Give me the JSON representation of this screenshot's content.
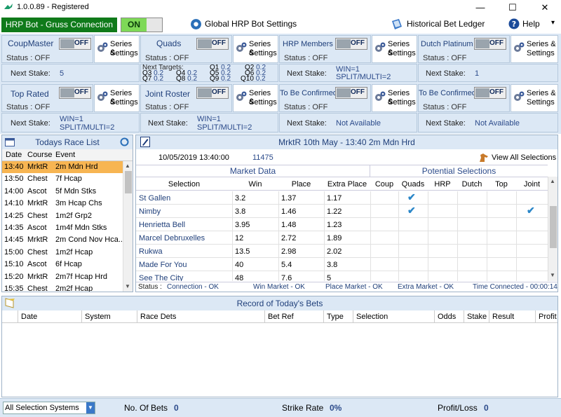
{
  "window": {
    "title": "1.0.0.89 - Registered",
    "minimize": "—",
    "maximize": "☐",
    "close": "✕"
  },
  "toolbar": {
    "connection": "HRP Bot - Gruss Connection",
    "on_label": "ON",
    "global_settings": "Global HRP Bot Settings",
    "ledger": "Historical Bet Ledger",
    "help": "Help",
    "help_caret": "▾"
  },
  "common": {
    "off": "OFF",
    "status_label": "Status :",
    "status_value": "OFF",
    "next_stake": "Next Stake:",
    "series": "Series &",
    "settings": "Settings"
  },
  "systems": {
    "coupmaster": {
      "name": "CoupMaster",
      "stake_label": "Next Stake:",
      "stake": "5"
    },
    "quads": {
      "name": "Quads",
      "targets_label": "Next Targets:",
      "targets": [
        [
          "Q1",
          "0.2"
        ],
        [
          "Q2",
          "0.2"
        ],
        [
          "Q3",
          "0.2"
        ],
        [
          "Q4",
          "0.2"
        ],
        [
          "Q5",
          "0.2"
        ],
        [
          "Q6",
          "0.2"
        ],
        [
          "Q7",
          "0.2"
        ],
        [
          "Q8",
          "0.2"
        ],
        [
          "Q9",
          "0.2"
        ],
        [
          "Q10",
          "0.2"
        ]
      ]
    },
    "hrp_members": {
      "name": "HRP Members",
      "stake_label": "Next Stake:",
      "stake1": "WIN=1",
      "stake2": "SPLIT/MULTI=2"
    },
    "dutch_platinum": {
      "name": "Dutch Platinum",
      "stake_label": "Next Stake:",
      "stake": "1"
    },
    "top_rated": {
      "name": "Top Rated",
      "stake_label": "Next Stake:",
      "stake1": "WIN=1",
      "stake2": "SPLIT/MULTI=2"
    },
    "joint_roster": {
      "name": "Joint Roster",
      "stake_label": "Next Stake:",
      "stake1": "WIN=1",
      "stake2": "SPLIT/MULTI=2"
    },
    "tbc1": {
      "name": "To Be Confirmed",
      "stake_label": "Next Stake:",
      "stake": "Not Available"
    },
    "tbc2": {
      "name": "To Be Confirmed",
      "stake_label": "Next Stake:",
      "stake": "Not Available"
    }
  },
  "racelist": {
    "title": "Todays Race List",
    "headers": {
      "date": "Date",
      "course": "Course",
      "event": "Event"
    },
    "rows": [
      {
        "time": "13:40",
        "course": "MrktR",
        "event": "2m Mdn Hrd"
      },
      {
        "time": "13:50",
        "course": "Chest",
        "event": "7f Hcap"
      },
      {
        "time": "14:00",
        "course": "Ascot",
        "event": "5f Mdn Stks"
      },
      {
        "time": "14:10",
        "course": "MrktR",
        "event": "3m Hcap Chs"
      },
      {
        "time": "14:25",
        "course": "Chest",
        "event": "1m2f Grp2"
      },
      {
        "time": "14:35",
        "course": "Ascot",
        "event": "1m4f Mdn Stks"
      },
      {
        "time": "14:45",
        "course": "MrktR",
        "event": "2m Cond Nov Hca..."
      },
      {
        "time": "15:00",
        "course": "Chest",
        "event": "1m2f Hcap"
      },
      {
        "time": "15:10",
        "course": "Ascot",
        "event": "6f Hcap"
      },
      {
        "time": "15:20",
        "course": "MrktR",
        "event": "2m7f Hcap Hrd"
      },
      {
        "time": "15:35",
        "course": "Chest",
        "event": "2m2f Hcap"
      }
    ]
  },
  "market": {
    "title": "MrktR  10th May - 13:40 2m Mdn Hrd",
    "datetime": "10/05/2019 13:40:00",
    "market_id": "11475",
    "view_all": "View All Selections",
    "market_data_label": "Market Data",
    "potential_label": "Potential Selections",
    "headers": {
      "selection": "Selection",
      "win": "Win",
      "place": "Place",
      "extra": "Extra Place",
      "coup": "Coup",
      "quads": "Quads",
      "hrp": "HRP",
      "dutch": "Dutch",
      "top": "Top",
      "joint": "Joint"
    },
    "rows": [
      {
        "name": "St Gallen",
        "win": "3.2",
        "place": "1.37",
        "extra": "1.17",
        "quads": true,
        "joint": false
      },
      {
        "name": "Nimby",
        "win": "3.8",
        "place": "1.46",
        "extra": "1.22",
        "quads": true,
        "joint": true
      },
      {
        "name": "Henrietta Bell",
        "win": "3.95",
        "place": "1.48",
        "extra": "1.23",
        "quads": false,
        "joint": false
      },
      {
        "name": "Marcel Debruxelles",
        "win": "12",
        "place": "2.72",
        "extra": "1.89",
        "quads": false,
        "joint": false
      },
      {
        "name": "Rukwa",
        "win": "13.5",
        "place": "2.98",
        "extra": "2.02",
        "quads": false,
        "joint": false
      },
      {
        "name": "Made For You",
        "win": "40",
        "place": "5.4",
        "extra": "3.8",
        "quads": false,
        "joint": false
      },
      {
        "name": "See The City",
        "win": "48",
        "place": "7.6",
        "extra": "5",
        "quads": false,
        "joint": false
      }
    ],
    "status": {
      "label": "Status :",
      "connection": "Connection - OK",
      "win": "Win Market - OK",
      "place": "Place Market - OK",
      "extra": "Extra Market - OK",
      "time": "Time Connected - 00:00:14"
    }
  },
  "bets": {
    "title": "Record of Today's Bets",
    "headers": [
      "Date",
      "System",
      "Race Dets",
      "Bet Ref",
      "Type",
      "Selection",
      "Odds",
      "Stake",
      "Result",
      "Profit"
    ]
  },
  "footer": {
    "filter": "All Selection Systems",
    "num_bets_label": "No. Of Bets",
    "num_bets": "0",
    "strike_label": "Strike Rate",
    "strike": "0%",
    "pl_label": "Profit/Loss",
    "pl": "0"
  }
}
